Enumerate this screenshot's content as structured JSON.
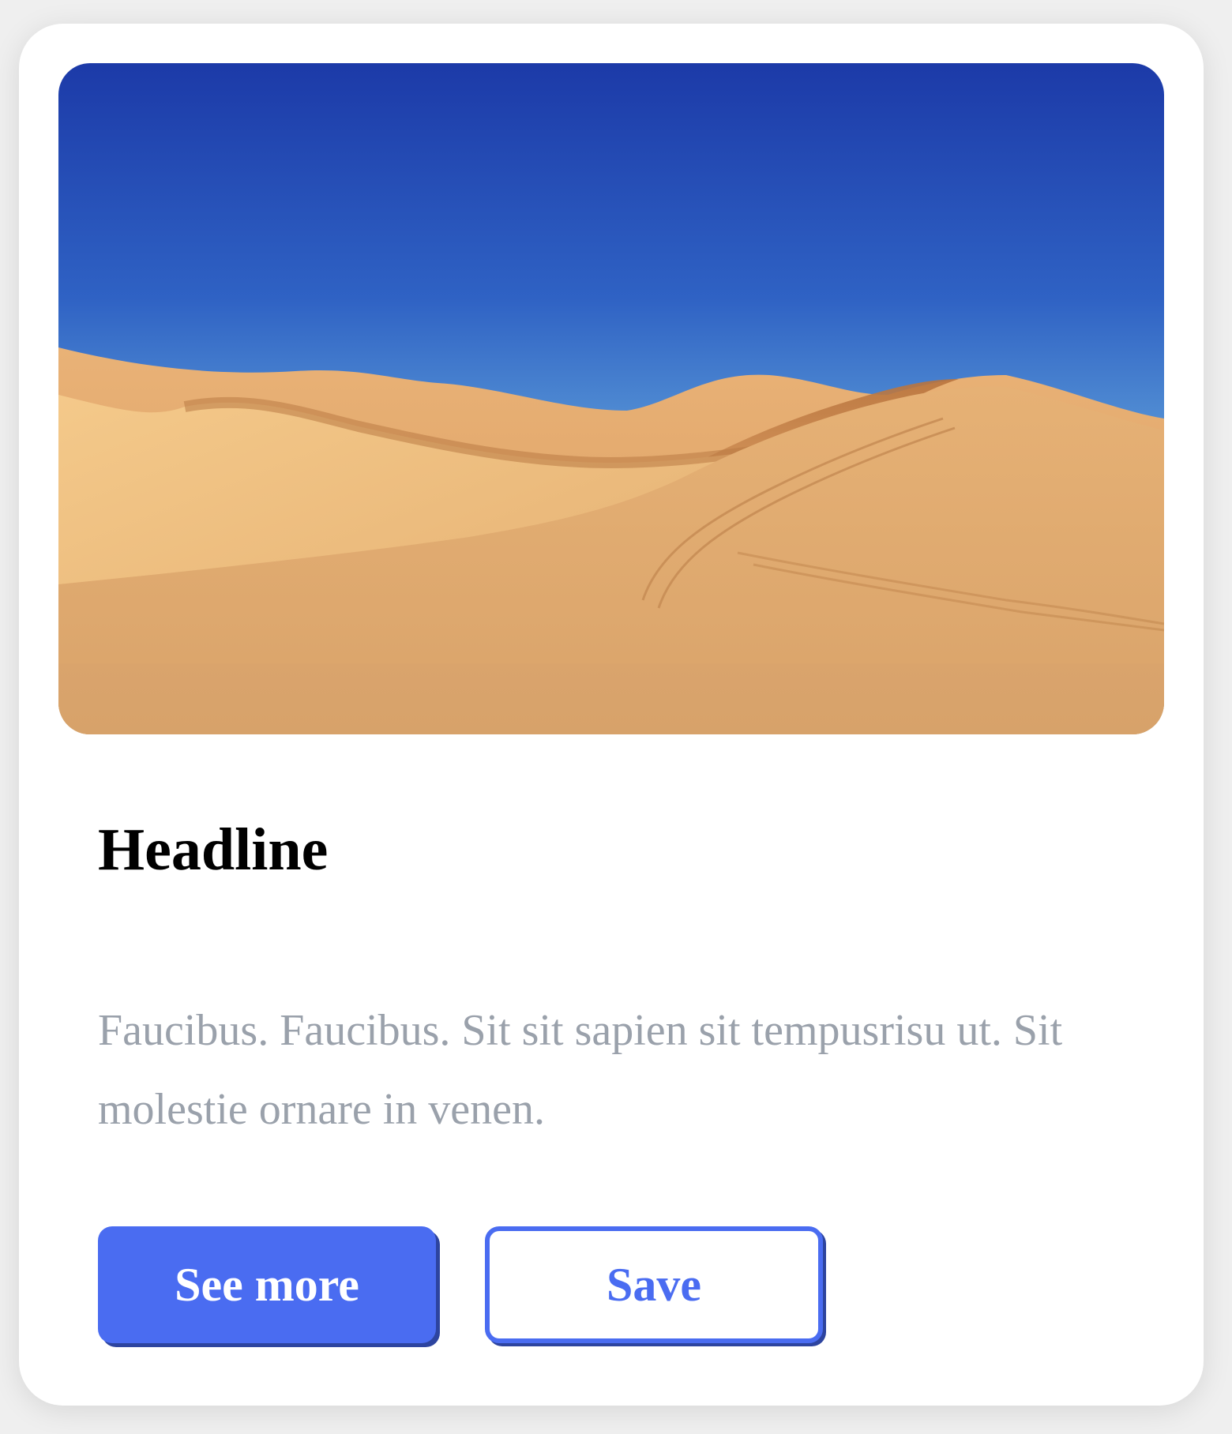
{
  "card": {
    "headline": "Headline",
    "body": "Faucibus. Faucibus. Sit sit sapien sit tempusrisu ut. Sit molestie ornare in venen.",
    "image_alt_icon": "desert-dunes-image",
    "buttons": {
      "primary_label": "See more",
      "secondary_label": "Save"
    }
  },
  "colors": {
    "accent": "#4a6cf1",
    "accent_shadow": "#2d449f",
    "body_text": "#9aa1ab",
    "background": "#efefef",
    "card": "#ffffff"
  }
}
